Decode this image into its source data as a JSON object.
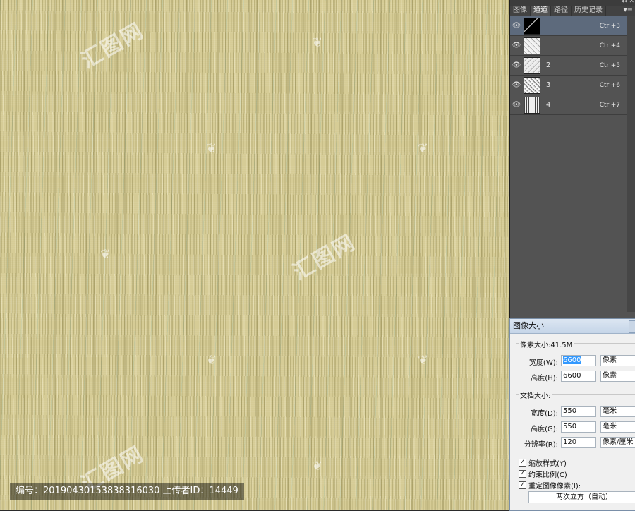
{
  "canvas": {
    "watermark_text": "汇图网",
    "footer": "编号：20190430153838316030 上传者ID：14449"
  },
  "panel": {
    "tabs": [
      "图像",
      "通道",
      "路径",
      "历史记录"
    ],
    "active_tab": "通道",
    "channels": [
      {
        "name": "",
        "shortcut": "Ctrl+3"
      },
      {
        "name": "",
        "shortcut": "Ctrl+4"
      },
      {
        "name": "2",
        "shortcut": "Ctrl+5"
      },
      {
        "name": "3",
        "shortcut": "Ctrl+6"
      },
      {
        "name": "4",
        "shortcut": "Ctrl+7"
      }
    ]
  },
  "dialog": {
    "title": "图像大小",
    "pixel_dimensions_label": "像素大小:41.5M",
    "pixel_width_label": "宽度(W):",
    "pixel_width_value": "6600",
    "pixel_width_unit": "像素",
    "pixel_height_label": "高度(H):",
    "pixel_height_value": "6600",
    "pixel_height_unit": "像素",
    "document_size_label": "文档大小:",
    "doc_width_label": "宽度(D):",
    "doc_width_value": "550",
    "doc_width_unit": "毫米",
    "doc_height_label": "高度(G):",
    "doc_height_value": "550",
    "doc_height_unit": "毫米",
    "resolution_label": "分辨率(R):",
    "resolution_value": "120",
    "resolution_unit": "像素/厘米",
    "scale_styles_label": "缩放样式(Y)",
    "constrain_label": "约束比例(C)",
    "resample_label": "重定图像像素(I):",
    "resample_method": "两次立方（自动）"
  }
}
